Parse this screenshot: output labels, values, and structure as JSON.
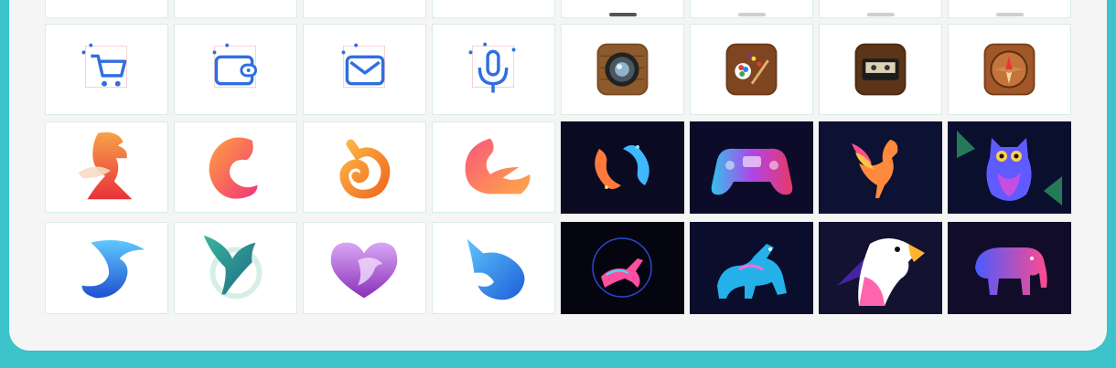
{
  "gallery": {
    "colors": {
      "background": "#3cc3cc",
      "panel": "#f5f5f5",
      "tile_border": "#d9ece8",
      "icon_blue": "#2f6fe0",
      "dark_tile": "#0a0b22"
    },
    "rows": [
      {
        "row": "partial-top",
        "items": [
          "tile-blank",
          "tile-blank",
          "tile-blank",
          "tile-blank",
          "tile-blank",
          "tile-blank",
          "tile-blank",
          "tile-blank"
        ]
      },
      {
        "row": "line-icons-and-skeuomorphic",
        "items": [
          "cart-icon",
          "wallet-icon",
          "mail-icon",
          "microphone-icon",
          "camera-app-icon",
          "paint-palette-app-icon",
          "cassette-app-icon",
          "compass-app-icon"
        ]
      },
      {
        "row": "gradient-logos-and-neon-art",
        "items": [
          "rooster-logo",
          "letter-c-logo",
          "fox-swirl-logo",
          "fox-tail-logo",
          "koi-fish-neon-art",
          "gamepad-neon-art",
          "rooster-neon-art",
          "owl-neon-art"
        ]
      },
      {
        "row": "gradient-logos-and-neon-art-2",
        "items": [
          "wave-bird-logo",
          "pegasus-logo",
          "heart-lion-logo",
          "unicorn-logo",
          "gazelle-neon-art",
          "dragon-neon-art",
          "eagle-neon-art",
          "elephant-neon-art"
        ]
      }
    ]
  }
}
